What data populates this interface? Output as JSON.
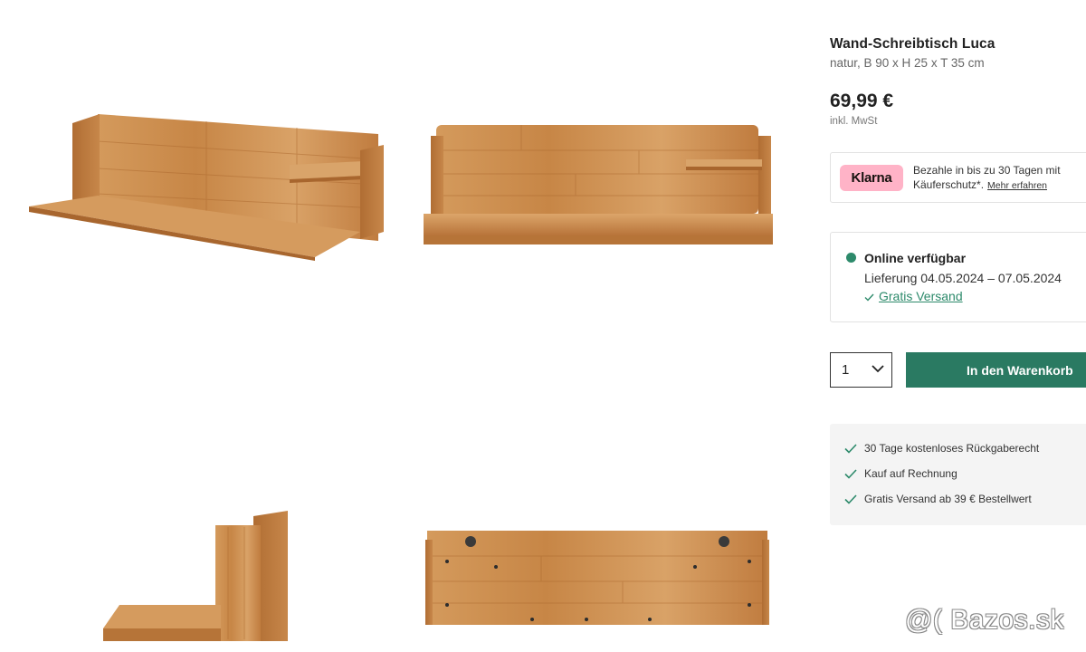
{
  "product": {
    "title": "Wand-Schreibtisch Luca",
    "subtitle": "natur, B 90 x H 25 x T 35 cm",
    "price": "69,99 €",
    "tax_note": "inkl. MwSt"
  },
  "klarna": {
    "logo_text": "Klarna",
    "line1": "Bezahle in bis zu 30 Tagen mit",
    "line2": "Käuferschutz*.",
    "link": "Mehr erfahren"
  },
  "availability": {
    "status": "Online verfügbar",
    "delivery": "Lieferung 04.05.2024 – 07.05.2024",
    "shipping_link": "Gratis Versand"
  },
  "purchase": {
    "quantity": "1",
    "cart_button": "In den Warenkorb"
  },
  "benefits": [
    "30 Tage kostenloses Rückgaberecht",
    "Kauf auf Rechnung",
    "Gratis Versand ab 39 € Bestellwert"
  ],
  "watermark": "@( Bazos.sk",
  "colors": {
    "accent_green": "#2a7a62",
    "klarna_pink": "#ffb3c7",
    "wood": "#c98a4b"
  },
  "icons": [
    "check-icon",
    "chevron-down-icon",
    "availability-dot"
  ]
}
